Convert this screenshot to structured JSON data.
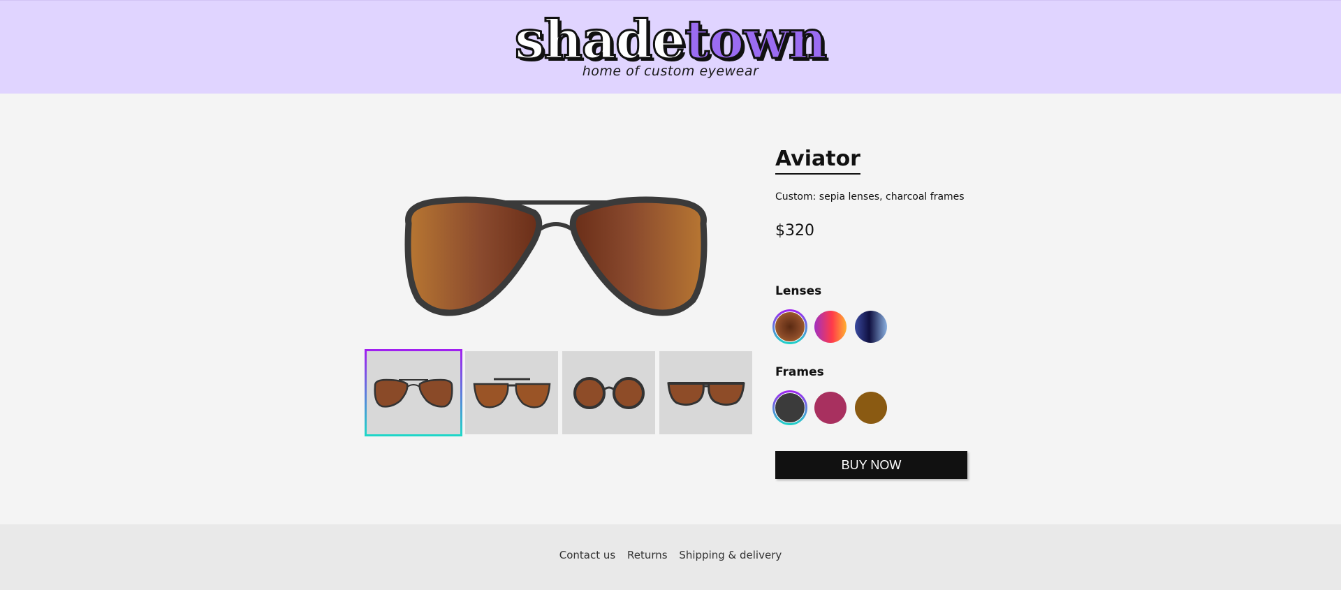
{
  "header": {
    "logo_part1": "shade",
    "logo_part2": "town",
    "tagline": "home of custom eyewear",
    "background": "#e0d4ff",
    "accent": "#9b6cf2"
  },
  "product": {
    "title": "Aviator",
    "description": "Custom: sepia lenses, charcoal frames",
    "price": "$320",
    "main_image": "aviator-sunglasses-sepia-charcoal",
    "thumbnails": [
      {
        "name": "aviator",
        "selected": true
      },
      {
        "name": "clubmaster",
        "selected": false
      },
      {
        "name": "round",
        "selected": false
      },
      {
        "name": "wayfarer",
        "selected": false
      }
    ]
  },
  "options": {
    "lenses_label": "Lenses",
    "frames_label": "Frames",
    "lenses": [
      {
        "name": "sepia",
        "color": "#8a4a28",
        "selected": true
      },
      {
        "name": "sunset",
        "color": "#ff4a4a",
        "selected": false
      },
      {
        "name": "midnight",
        "color": "#1e1e6a",
        "selected": false
      }
    ],
    "frames": [
      {
        "name": "charcoal",
        "color": "#3b3b3b",
        "selected": true
      },
      {
        "name": "raspberry",
        "color": "#a8305f",
        "selected": false
      },
      {
        "name": "tortoise",
        "color": "#8a5a12",
        "selected": false
      }
    ]
  },
  "actions": {
    "buy_label": "BUY NOW"
  },
  "footer": {
    "links": [
      "Contact us",
      "Returns",
      "Shipping & delivery"
    ]
  }
}
